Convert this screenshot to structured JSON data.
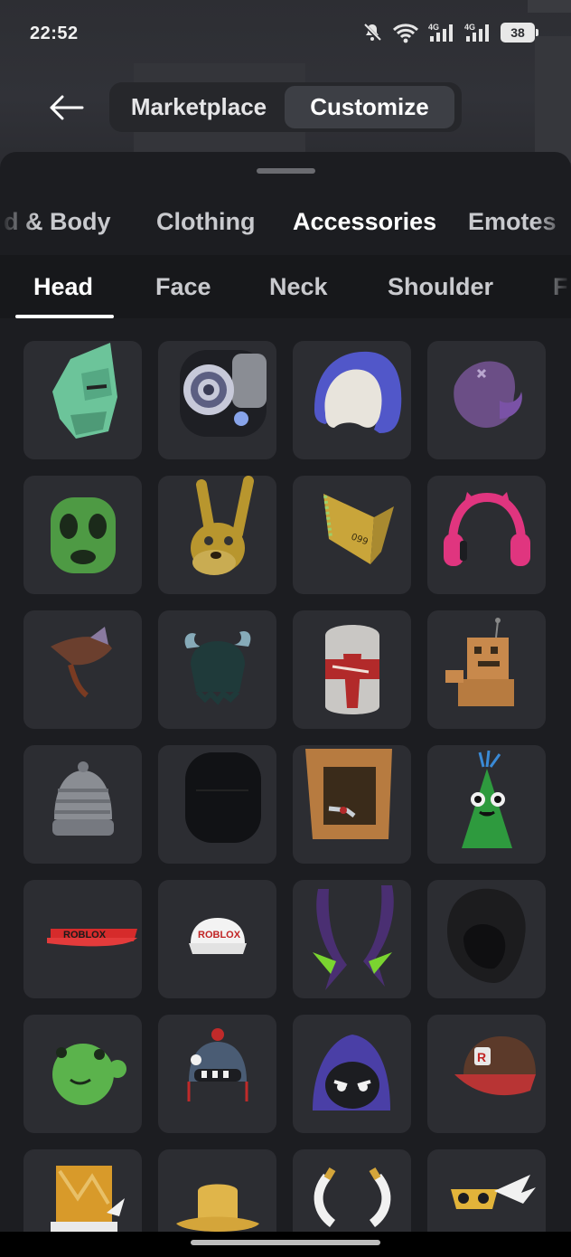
{
  "status_bar": {
    "time": "22:52",
    "battery": "38",
    "net_label_1": "4G",
    "net_label_2": "4G",
    "icons": [
      "mute-icon",
      "wifi-icon",
      "signal-4g-icon",
      "signal-4g-icon",
      "battery-icon"
    ]
  },
  "header": {
    "back_icon": "arrow-left-icon",
    "tabs": [
      {
        "label": "Marketplace",
        "selected": false
      },
      {
        "label": "Customize",
        "selected": true
      }
    ]
  },
  "categories": {
    "items": [
      {
        "label": "d & Body",
        "active": false
      },
      {
        "label": "Clothing",
        "active": false
      },
      {
        "label": "Accessories",
        "active": true
      },
      {
        "label": "Emotes",
        "active": false
      }
    ]
  },
  "subcategories": {
    "items": [
      {
        "label": "Head",
        "active": true
      },
      {
        "label": "Face",
        "active": false
      },
      {
        "label": "Neck",
        "active": false
      },
      {
        "label": "Shoulder",
        "active": false
      },
      {
        "label": "F",
        "active": false
      }
    ]
  },
  "items": [
    {
      "name": "green-golem-helmet"
    },
    {
      "name": "robot-speaker-head"
    },
    {
      "name": "blue-hood"
    },
    {
      "name": "purple-ninja-mask"
    },
    {
      "name": "green-cactus-head"
    },
    {
      "name": "yellow-rabbit-head"
    },
    {
      "name": "golden-ticket-hat"
    },
    {
      "name": "pink-cat-headphones"
    },
    {
      "name": "brown-feather-hat"
    },
    {
      "name": "horned-viking-helmet"
    },
    {
      "name": "white-red-knight-helmet"
    },
    {
      "name": "cardboard-box-robot"
    },
    {
      "name": "grey-beanie"
    },
    {
      "name": "black-head"
    },
    {
      "name": "cardboard-box-head"
    },
    {
      "name": "green-party-hat-creature"
    },
    {
      "name": "red-visor",
      "text": "ROBLOX"
    },
    {
      "name": "white-cap",
      "text": "ROBLOX"
    },
    {
      "name": "purple-green-horns"
    },
    {
      "name": "black-hood"
    },
    {
      "name": "green-blob-head"
    },
    {
      "name": "robot-beanie"
    },
    {
      "name": "purple-hood-face"
    },
    {
      "name": "brown-red-cap",
      "text": "R"
    },
    {
      "name": "cake-top-hat"
    },
    {
      "name": "yellow-hat"
    },
    {
      "name": "golden-horns"
    },
    {
      "name": "winged-mask"
    }
  ],
  "colors": {
    "sheet": "#1c1d21",
    "tile": "#2c2d32",
    "active_text": "#ffffff",
    "inactive_text": "#c9cace"
  }
}
